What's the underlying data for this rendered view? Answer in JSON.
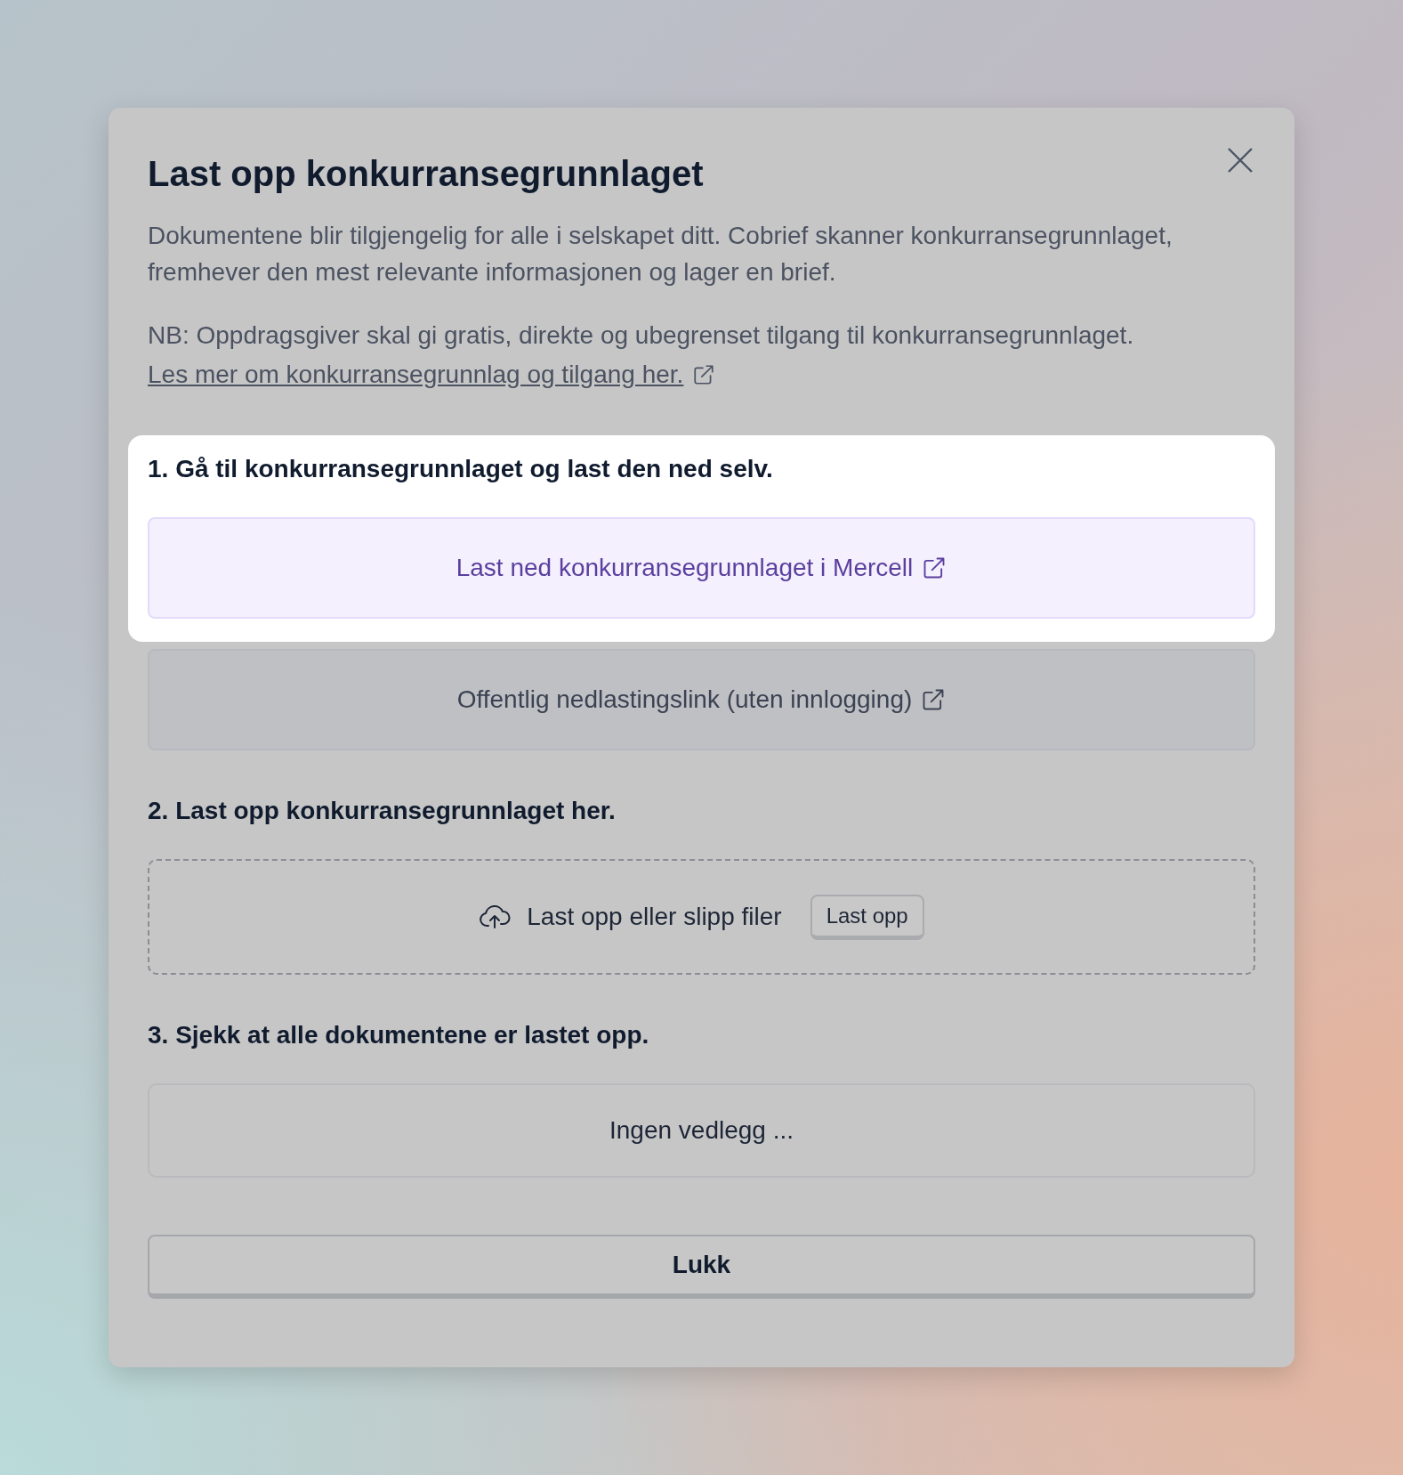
{
  "dialog": {
    "title": "Last opp konkurransegrunnlaget",
    "intro": "Dokumentene blir tilgjengelig for alle i selskapet ditt. Cobrief skanner konkurransegrunnlaget, fremhever den mest relevante informasjonen og lager en brief.",
    "note": "NB: Oppdragsgiver skal gi gratis, direkte og ubegrenset tilgang til konkurransegrunnlaget.",
    "note_link": "Les mer om konkurransegrunnlag og tilgang her.",
    "steps": [
      {
        "heading": "1. Gå til konkurransegrunnlaget og last den ned selv.",
        "highlighted": true,
        "items": [
          {
            "kind": "link",
            "label": "Last ned konkurransegrunnlaget i Mercell",
            "highlighted": true
          },
          {
            "kind": "link",
            "label": "Offentlig nedlastingslink (uten innlogging)",
            "highlighted": false
          }
        ]
      },
      {
        "heading": "2. Last opp konkurransegrunnlaget her.",
        "highlighted": false,
        "items": [
          {
            "kind": "dropzone",
            "label": "Last opp eller slipp filer",
            "button": "Last opp",
            "highlighted": false
          }
        ]
      },
      {
        "heading": "3. Sjekk at alle dokumentene er lastet opp.",
        "highlighted": false,
        "items": [
          {
            "kind": "empty",
            "label": "Ingen vedlegg ...",
            "highlighted": false
          }
        ]
      }
    ],
    "close_button": "Lukk"
  }
}
